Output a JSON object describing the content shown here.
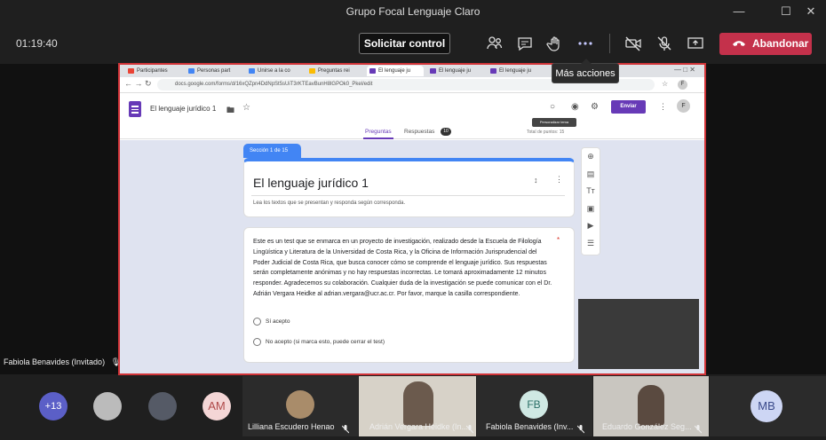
{
  "window": {
    "title": "Grupo Focal Lenguaje Claro"
  },
  "toolbar": {
    "timer": "01:19:40",
    "request_control": "Solicitar control",
    "leave": "Abandonar",
    "more_tooltip": "Más acciones"
  },
  "browser": {
    "tabs": [
      {
        "label": "Participantes",
        "color": "#ea4335"
      },
      {
        "label": "Personas part",
        "color": "#4285f4"
      },
      {
        "label": "Unirse a la co",
        "color": "#4285f4"
      },
      {
        "label": "Preguntas rei",
        "color": "#fbbc04"
      },
      {
        "label": "El lenguaje ju",
        "color": "#673ab7"
      },
      {
        "label": "El lenguaje ju",
        "color": "#673ab7"
      },
      {
        "label": "El lenguaje ju",
        "color": "#673ab7"
      }
    ],
    "url": "docs.google.com/forms/d/16xQZpn4DdNpSt5sUiT3rKTEavBunH8lGPOk0_Pkel/edit"
  },
  "form": {
    "doc_title": "El lenguaje jurídico 1",
    "send_label": "Enviar",
    "avatar_letter": "F",
    "personalize_tip": "Personalizar tema",
    "tab_questions": "Preguntas",
    "tab_answers": "Respuestas",
    "answers_count": "10",
    "total_points": "Total de puntos: 15",
    "section_tab": "Sección 1 de 15",
    "section_title": "El lenguaje jurídico 1",
    "section_desc": "Lea los textos que se presentan y responda según corresponda.",
    "question_text": "Este es un test que se enmarca en un proyecto de investigación, realizado desde la Escuela de Filología Lingüística y Literatura de la Universidad de Costa Rica, y la Oficina de Información Jurisprudencial del Poder Judicial de Costa Rica, que busca conocer cómo se comprende el lenguaje jurídico. Sus respuestas serán completamente anónimas y no hay respuestas incorrectas. Le tomará aproximadamente 12 minutos responder. Agradecemos su colaboración. Cualquier duda de la investigación se puede comunicar con el Dr. Adrián Vergara Heidke al adrian.vergara@ucr.ac.cr. Por favor, marque la casilla correspondiente.",
    "required_mark": "*",
    "option1": "Sí acepto",
    "option2": "No acepto (si marca esto, puede cerrar el test)"
  },
  "presenter_name": "Fabiola Benavides (Invitado)",
  "participants": {
    "more_count": "+13",
    "am_initials": "AM",
    "p1_name": "Lilliana Escudero Henao",
    "p2_name": "Adrián Vergara Heidke (In...",
    "fb_initials": "FB",
    "p3_name": "Fabiola Benavides (Inv...",
    "p4_name": "Eduardo González Seg...",
    "mb_initials": "MB"
  }
}
